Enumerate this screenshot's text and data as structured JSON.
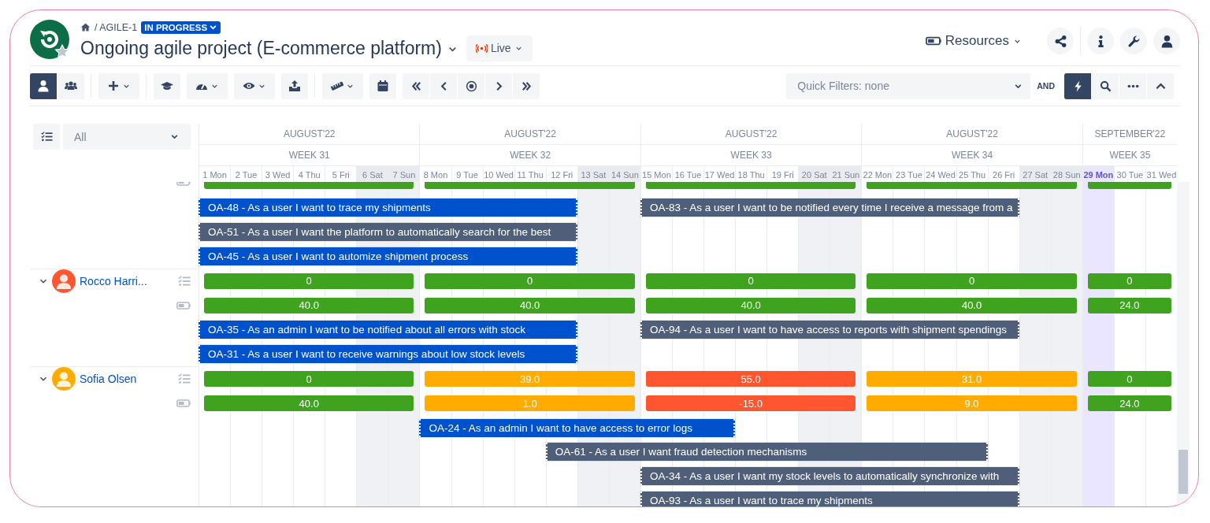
{
  "project": {
    "breadcrumb": "/ AGILE-1",
    "status": "IN PROGRESS",
    "title": "Ongoing agile project (E-commerce platform)",
    "mode": "Live"
  },
  "header_tools": {
    "resources": "Resources",
    "buttons": [
      {
        "kind": "share"
      },
      {
        "kind": "info"
      },
      {
        "kind": "wrench"
      },
      {
        "kind": "user"
      }
    ]
  },
  "toolbar": {
    "view_modes": [
      {
        "kind": "user",
        "selected": true
      },
      {
        "kind": "team",
        "selected": false
      }
    ],
    "tool_groups": [
      {
        "tools": [
          {
            "kind": "plus",
            "dropdown": true
          }
        ]
      },
      {
        "tools": [
          {
            "kind": "cap",
            "dropdown": false
          },
          {
            "kind": "gauge",
            "dropdown": true
          },
          {
            "kind": "eye",
            "dropdown": true
          },
          {
            "kind": "upload",
            "dropdown": false
          }
        ]
      },
      {
        "tools": [
          {
            "kind": "ruler",
            "dropdown": true
          },
          {
            "kind": "calendar",
            "dropdown": false
          }
        ]
      }
    ],
    "navigation": [
      {
        "kind": "first"
      },
      {
        "kind": "prev"
      },
      {
        "kind": "today"
      },
      {
        "kind": "next"
      },
      {
        "kind": "last"
      }
    ],
    "quick_filter": {
      "placeholder": "Quick Filters: none"
    },
    "operator": "AND",
    "actions": [
      {
        "kind": "lightning",
        "selected": true
      },
      {
        "kind": "search",
        "selected": false
      },
      {
        "kind": "more",
        "selected": false
      },
      {
        "kind": "collapse",
        "selected": false
      }
    ]
  },
  "gantt": {
    "filter": {
      "value": "All"
    },
    "weeks": [
      {
        "month": "AUGUST'22",
        "label": "WEEK 31"
      },
      {
        "month": "AUGUST'22",
        "label": "WEEK 32"
      },
      {
        "month": "AUGUST'22",
        "label": "WEEK 33"
      },
      {
        "month": "AUGUST'22",
        "label": "WEEK 34"
      },
      {
        "month": "SEPTEMBER'22",
        "label": "WEEK 35"
      }
    ],
    "days": [
      {
        "label": "1 Mon",
        "weekend": false,
        "today": false
      },
      {
        "label": "2 Tue",
        "weekend": false,
        "today": false
      },
      {
        "label": "3 Wed",
        "weekend": false,
        "today": false
      },
      {
        "label": "4 Thu",
        "weekend": false,
        "today": false
      },
      {
        "label": "5 Fri",
        "weekend": false,
        "today": false
      },
      {
        "label": "6 Sat",
        "weekend": true,
        "today": false
      },
      {
        "label": "7 Sun",
        "weekend": true,
        "today": false
      },
      {
        "label": "8 Mon",
        "weekend": false,
        "today": false
      },
      {
        "label": "9 Tue",
        "weekend": false,
        "today": false
      },
      {
        "label": "10 Wed",
        "weekend": false,
        "today": false
      },
      {
        "label": "11 Thu",
        "weekend": false,
        "today": false
      },
      {
        "label": "12 Fri",
        "weekend": false,
        "today": false
      },
      {
        "label": "13 Sat",
        "weekend": true,
        "today": false
      },
      {
        "label": "14 Sun",
        "weekend": true,
        "today": false
      },
      {
        "label": "15 Mon",
        "weekend": false,
        "today": false
      },
      {
        "label": "16 Tue",
        "weekend": false,
        "today": false
      },
      {
        "label": "17 Wed",
        "weekend": false,
        "today": false
      },
      {
        "label": "18 Thu",
        "weekend": false,
        "today": false
      },
      {
        "label": "19 Fri",
        "weekend": false,
        "today": false
      },
      {
        "label": "20 Sat",
        "weekend": true,
        "today": false
      },
      {
        "label": "21 Sun",
        "weekend": true,
        "today": false
      },
      {
        "label": "22 Mon",
        "weekend": false,
        "today": false
      },
      {
        "label": "23 Tue",
        "weekend": false,
        "today": false
      },
      {
        "label": "24 Wed",
        "weekend": false,
        "today": false
      },
      {
        "label": "25 Thu",
        "weekend": false,
        "today": false
      },
      {
        "label": "26 Fri",
        "weekend": false,
        "today": false
      },
      {
        "label": "27 Sat",
        "weekend": true,
        "today": false
      },
      {
        "label": "28 Sun",
        "weekend": true,
        "today": false
      },
      {
        "label": "29 Mon",
        "weekend": false,
        "today": true
      },
      {
        "label": "30 Tue",
        "weekend": false,
        "today": false
      },
      {
        "label": "31 Wed",
        "weekend": false,
        "today": false
      }
    ],
    "groups": [
      {
        "clipped": true,
        "capacity": [
          {
            "color": "#3fa31f"
          },
          {
            "color": "#3fa31f"
          },
          {
            "color": "#3fa31f"
          },
          {
            "color": "#3fa31f"
          },
          {
            "color": "#3fa31f"
          }
        ],
        "task_rows": [
          {
            "tasks": [
              {
                "label": "OA-48 - As a user I want to trace my shipments",
                "color": "#0052cc"
              },
              {
                "label": "OA-83 - As a user I want to be notified every time I receive a message from a",
                "color": "#505f79"
              }
            ]
          },
          {
            "tasks": [
              {
                "label": "OA-51 - As a user I want the platform to automatically search for the best",
                "color": "#505f79"
              }
            ]
          },
          {
            "tasks": [
              {
                "label": "OA-45 - As a user I want to automize shipment process",
                "color": "#0052cc"
              }
            ]
          }
        ]
      },
      {
        "resource": {
          "name": "Rocco Harri...",
          "expanded": true,
          "color": "#ff5630"
        },
        "workload": [
          {
            "value": "0",
            "color": "#3fa31f"
          },
          {
            "value": "0",
            "color": "#3fa31f"
          },
          {
            "value": "0",
            "color": "#3fa31f"
          },
          {
            "value": "0",
            "color": "#3fa31f"
          },
          {
            "value": "0",
            "color": "#3fa31f"
          }
        ],
        "capacity": [
          {
            "value": "40.0",
            "color": "#3fa31f"
          },
          {
            "value": "40.0",
            "color": "#3fa31f"
          },
          {
            "value": "40.0",
            "color": "#3fa31f"
          },
          {
            "value": "40.0",
            "color": "#3fa31f"
          },
          {
            "value": "24.0",
            "color": "#3fa31f"
          }
        ],
        "task_rows": [
          {
            "tasks": [
              {
                "label": "OA-35 - As an admin I want to be notified about all errors with stock",
                "color": "#0052cc"
              },
              {
                "label": "OA-94 - As a user I want to have access to reports with shipment spendings",
                "color": "#505f79"
              }
            ]
          },
          {
            "tasks": [
              {
                "label": "OA-31 - As a user I want to receive warnings about low stock levels",
                "color": "#0052cc"
              }
            ]
          }
        ]
      },
      {
        "resource": {
          "name": "Sofia Olsen",
          "expanded": true,
          "color": "#ffab00"
        },
        "workload": [
          {
            "value": "0",
            "color": "#3fa31f"
          },
          {
            "value": "39.0",
            "color": "#ffab00"
          },
          {
            "value": "55.0",
            "color": "#ff5630"
          },
          {
            "value": "31.0",
            "color": "#ffab00"
          },
          {
            "value": "0",
            "color": "#3fa31f"
          }
        ],
        "capacity": [
          {
            "value": "40.0",
            "color": "#3fa31f"
          },
          {
            "value": "1.0",
            "color": "#ffab00"
          },
          {
            "value": "-15.0",
            "color": "#ff5630"
          },
          {
            "value": "9.0",
            "color": "#ffab00"
          },
          {
            "value": "24.0",
            "color": "#3fa31f"
          }
        ],
        "task_rows": [
          {
            "tasks": [
              {
                "label": "OA-24 - As an admin I want to have access to error logs",
                "color": "#0052cc"
              }
            ]
          },
          {
            "tasks": [
              {
                "label": "OA-61 - As a user I want fraud detection mechanisms",
                "color": "#505f79"
              }
            ]
          },
          {
            "tasks": [
              {
                "label": "OA-34 - As a user I want my stock levels to automatically synchronize with",
                "color": "#505f79"
              }
            ]
          },
          {
            "tasks": [
              {
                "label": "OA-93 - As a user I want to trace my shipments",
                "color": "#505f79"
              }
            ]
          }
        ]
      }
    ]
  }
}
